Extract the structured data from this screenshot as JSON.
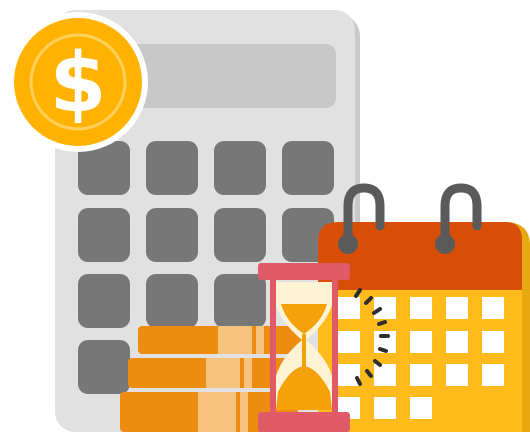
{
  "illustration": {
    "currency_symbol": "$",
    "icons": [
      "calculator-icon",
      "dollar-coin-icon",
      "coin-stack-icon",
      "hourglass-icon",
      "calendar-icon"
    ]
  },
  "colors": {
    "calculator_body": "#e1e1e1",
    "calculator_shadow": "#c6c6c6",
    "calculator_display": "#c8c8c8",
    "calculator_keys": "#777777",
    "coin_gold": "#ffb300",
    "coin_inner_ring": "#ffc53a",
    "coin_stack_orange": "#ec8d12",
    "coin_stack_light": "#f6c37f",
    "hourglass_frame": "#e05a67",
    "hourglass_glass": "#fff3d6",
    "sand": "#f5a20a",
    "calendar_header": "#d84e07",
    "calendar_body": "#ffbb1c",
    "calendar_right_edge": "#e8a80f",
    "calendar_cells": "#ffffff",
    "calendar_ring": "#5a5a5a",
    "clock_dashes": "#2e2e2e"
  }
}
